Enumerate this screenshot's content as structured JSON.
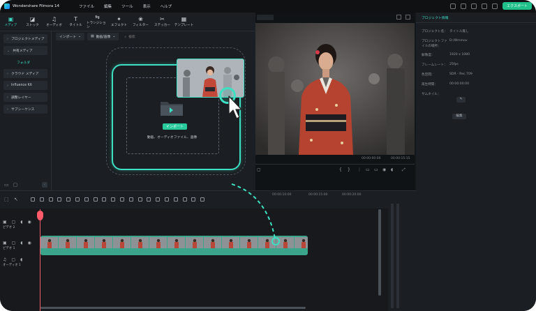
{
  "app": {
    "title": "Wondershare Filmora 14",
    "menu": [
      "ファイル",
      "編集",
      "ツール",
      "表示",
      "ヘルプ"
    ],
    "export_label": "エクスポート"
  },
  "library": {
    "tabs": [
      {
        "label": "メディア",
        "icon": "media-icon",
        "active": true
      },
      {
        "label": "ストック",
        "icon": "stock-icon"
      },
      {
        "label": "オーディオ",
        "icon": "music-note-icon"
      },
      {
        "label": "タイトル",
        "icon": "title-icon"
      },
      {
        "label": "トランジション",
        "icon": "transition-icon"
      },
      {
        "label": "エフェクト",
        "icon": "effects-icon"
      },
      {
        "label": "フィルター",
        "icon": "filter-icon"
      },
      {
        "label": "ステッカー",
        "icon": "sticker-icon"
      },
      {
        "label": "テンプレート",
        "icon": "template-icon"
      }
    ],
    "nav": {
      "items": [
        {
          "label": "プロジェクトメディア"
        },
        {
          "label": "共有メディア"
        },
        {
          "label": "フォルダ",
          "sub": true
        },
        {
          "label": "クラウド メディア"
        },
        {
          "label": "Influence Kit"
        },
        {
          "label": "調整レイヤー"
        },
        {
          "label": "サブシーケンス"
        }
      ]
    },
    "toolbar": {
      "import_dropdown": "インポート",
      "filter_dropdown": "動画/画像",
      "search_placeholder": "検索"
    },
    "dropzone": {
      "import_button": "インポート",
      "hint": "動画、オーディオファイル、画像"
    }
  },
  "properties": {
    "tab": "プロジェクト情報",
    "rows": [
      {
        "label": "プロジェクト名：",
        "value": "タイトル無し"
      },
      {
        "label": "プロジェクトファイルの場所：",
        "value": "D:/Wmmov"
      },
      {
        "label": "解像度：",
        "value": "1920 x 1080"
      },
      {
        "label": "フレームレート：",
        "value": "25fps"
      },
      {
        "label": "色空間：",
        "value": "SDR - Rec.709"
      },
      {
        "label": "再生時間：",
        "value": "00:00:00:00"
      },
      {
        "label": "サムネイル：",
        "value": ""
      }
    ],
    "edit_button": "編集"
  },
  "preview": {
    "timecode_current": "00:00:00:00",
    "timecode_total": "00:00:15:15"
  },
  "timeline": {
    "ruler_labels": [
      "00:00:10:00",
      "00:00:15:00",
      "00:00:20:00"
    ],
    "tracks": [
      {
        "label": "ビデオ 2"
      },
      {
        "label": "ビデオ 1"
      },
      {
        "label": "オーディオ 1"
      }
    ]
  },
  "colors": {
    "accent": "#3de0c2",
    "playhead": "#ff5a6a",
    "clip": "#3aa58a"
  }
}
